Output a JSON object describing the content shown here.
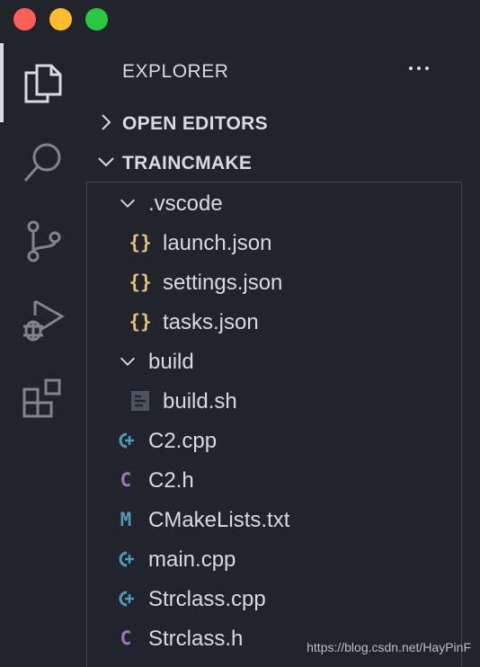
{
  "window": {
    "traffic_lights": {
      "close_color": "#ff5f57",
      "minimize_color": "#febc2e",
      "maximize_color": "#28c840"
    }
  },
  "activity_bar": {
    "items": [
      {
        "icon": "files-icon",
        "active": true
      },
      {
        "icon": "search-icon",
        "active": false
      },
      {
        "icon": "source-control-icon",
        "active": false
      },
      {
        "icon": "run-debug-icon",
        "active": false
      },
      {
        "icon": "extensions-icon",
        "active": false
      }
    ]
  },
  "explorer": {
    "title": "EXPLORER",
    "more_icon": "ellipsis-icon",
    "open_editors_label": "OPEN EDITORS",
    "folder_label": "TRAINCMAKE",
    "tree": [
      {
        "label": ".vscode",
        "type": "folder",
        "expanded": true
      },
      {
        "label": "launch.json",
        "type": "json"
      },
      {
        "label": "settings.json",
        "type": "json"
      },
      {
        "label": "tasks.json",
        "type": "json"
      },
      {
        "label": "build",
        "type": "folder",
        "expanded": true
      },
      {
        "label": "build.sh",
        "type": "shell"
      },
      {
        "label": "C2.cpp",
        "type": "cpp"
      },
      {
        "label": "C2.h",
        "type": "c-header"
      },
      {
        "label": "CMakeLists.txt",
        "type": "cmake"
      },
      {
        "label": "main.cpp",
        "type": "cpp"
      },
      {
        "label": "Strclass.cpp",
        "type": "cpp"
      },
      {
        "label": "Strclass.h",
        "type": "c-header"
      }
    ],
    "icon_glyphs": {
      "json": "{}",
      "c_header": "C",
      "cmake": "M",
      "cpp": "C"
    },
    "colors": {
      "json": "#e5c07b",
      "c_header": "#a074c4",
      "cmake": "#519aba",
      "cpp": "#519aba",
      "shell": "#5c6370"
    }
  },
  "watermark": "https://blog.csdn.net/HayPinF"
}
